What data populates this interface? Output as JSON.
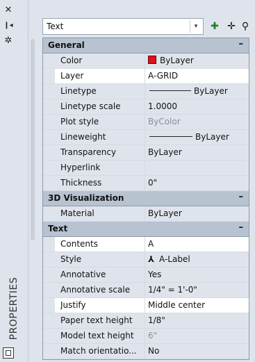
{
  "strip": {
    "close_icon": "✕",
    "autohide_icon": "❙◂",
    "settings_icon": "✲",
    "title": "PROPERTIES"
  },
  "topbar": {
    "selection_value": "Text",
    "dropdown_arrow": "▾",
    "quick_select_icon": "✚",
    "pickadd_icon": "✛",
    "select_objects_icon": "⚲"
  },
  "sections": [
    {
      "title": "General",
      "collapse": "–",
      "rows": [
        {
          "label": "Color",
          "value": "ByLayer"
        },
        {
          "label": "Layer",
          "value": "A-GRID"
        },
        {
          "label": "Linetype",
          "value": "ByLayer"
        },
        {
          "label": "Linetype scale",
          "value": "1.0000"
        },
        {
          "label": "Plot style",
          "value": "ByColor"
        },
        {
          "label": "Lineweight",
          "value": "ByLayer"
        },
        {
          "label": "Transparency",
          "value": "ByLayer"
        },
        {
          "label": "Hyperlink",
          "value": ""
        },
        {
          "label": "Thickness",
          "value": "0\""
        }
      ]
    },
    {
      "title": "3D Visualization",
      "collapse": "–",
      "rows": [
        {
          "label": "Material",
          "value": "ByLayer"
        }
      ]
    },
    {
      "title": "Text",
      "collapse": "–",
      "rows": [
        {
          "label": "Contents",
          "value": "A"
        },
        {
          "label": "Style",
          "value": "A-Label"
        },
        {
          "label": "Annotative",
          "value": "Yes"
        },
        {
          "label": "Annotative scale",
          "value": "1/4\" = 1'-0\""
        },
        {
          "label": "Justify",
          "value": "Middle center"
        },
        {
          "label": "Paper text height",
          "value": "1/8\""
        },
        {
          "label": "Model text height",
          "value": "6\""
        },
        {
          "label": "Match orientatio...",
          "value": "No"
        }
      ]
    }
  ],
  "colors": {
    "color_swatch": "#e0121b",
    "section_header": "#b8c3d1",
    "row_background": "#dfe4ec",
    "selected_row": "#ffffff"
  }
}
